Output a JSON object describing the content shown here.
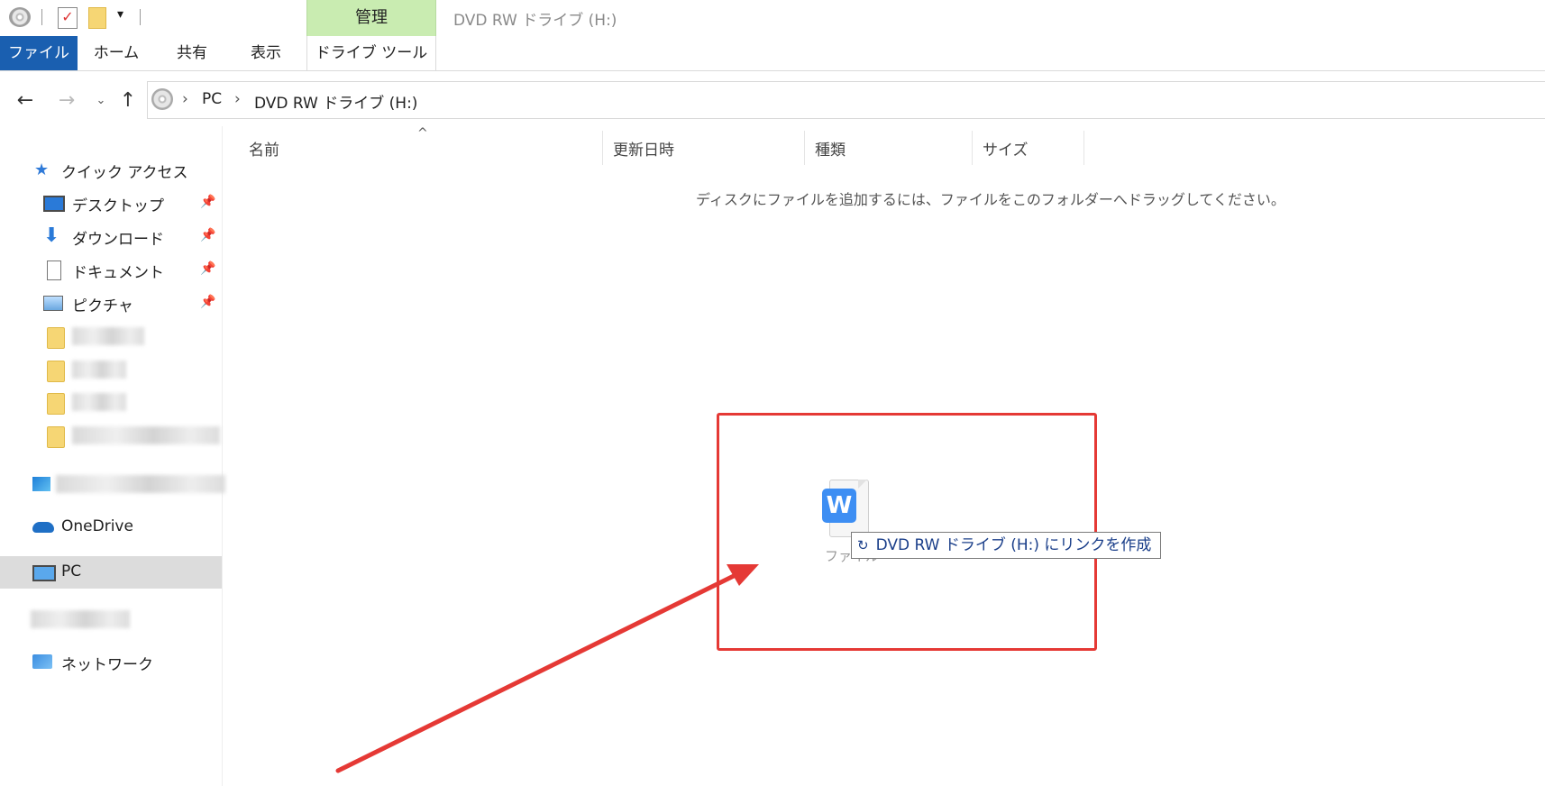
{
  "window": {
    "title": "DVD RW ドライブ (H:)"
  },
  "quick_access_toolbar": [
    "dvd-drive-icon",
    "properties-icon",
    "new-folder-icon",
    "customize-dropdown-icon"
  ],
  "ribbon": {
    "context_group_label": "管理",
    "tabs": [
      {
        "label": "ファイル",
        "active": true
      },
      {
        "label": "ホーム"
      },
      {
        "label": "共有"
      },
      {
        "label": "表示"
      },
      {
        "label": "ドライブ ツール"
      }
    ]
  },
  "navigation": {
    "buttons": [
      "back",
      "forward",
      "recent-locations",
      "up"
    ],
    "breadcrumb": [
      "PC",
      "DVD RW ドライブ (H:)"
    ]
  },
  "sidebar": {
    "quick_access": {
      "label": "クイック アクセス"
    },
    "pinned": [
      {
        "label": "デスクトップ",
        "icon": "desktop-icon"
      },
      {
        "label": "ダウンロード",
        "icon": "download-icon"
      },
      {
        "label": "ドキュメント",
        "icon": "documents-icon"
      },
      {
        "label": "ピクチャ",
        "icon": "pictures-icon"
      }
    ],
    "onedrive": {
      "label": "OneDrive"
    },
    "pc": {
      "label": "PC",
      "selected": true
    },
    "network": {
      "label": "ネットワーク"
    }
  },
  "list": {
    "columns": [
      "名前",
      "更新日時",
      "種類",
      "サイズ"
    ],
    "empty_message": "ディスクにファイルを追加するには、ファイルをこのフォルダーへドラッグしてください。"
  },
  "drag": {
    "file_caption": "ファイル",
    "tooltip": "DVD RW ドライブ (H:) にリンクを作成",
    "badge_letter": "W"
  },
  "colors": {
    "file_tab": "#1a5fb0",
    "manage_tab": "#c9ecb1",
    "annotation_red": "#e53935",
    "wps_badge": "#3d8ef3"
  }
}
